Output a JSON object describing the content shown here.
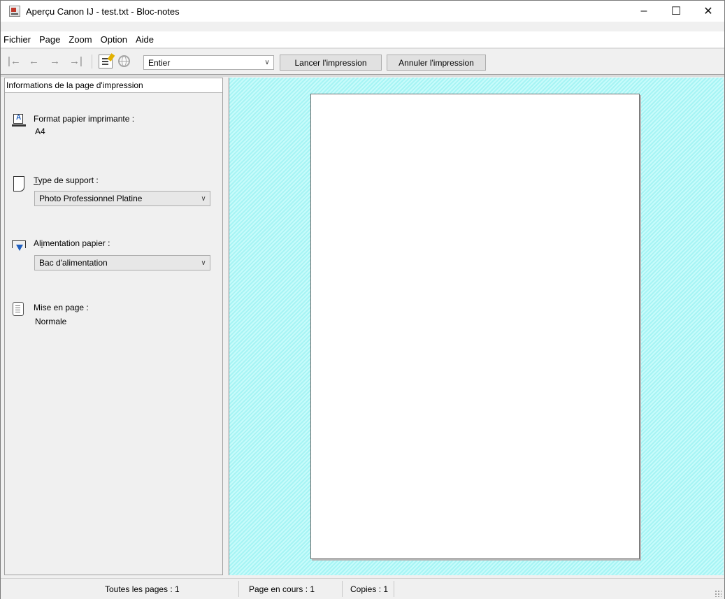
{
  "window": {
    "title": "Aperçu Canon IJ - test.txt - Bloc-notes",
    "controls": {
      "minimize": "–",
      "maximize": "☐",
      "close": "✕"
    }
  },
  "menu": [
    "Fichier",
    "Page",
    "Zoom",
    "Option",
    "Aide"
  ],
  "toolbar": {
    "nav_icons": [
      "first-page-icon",
      "previous-page-icon",
      "next-page-icon",
      "last-page-icon"
    ],
    "zoom_value": "Entier",
    "start_print_label": "Lancer l'impression",
    "cancel_print_label": "Annuler l'impression"
  },
  "panel": {
    "header": "Informations de la page d'impression",
    "paper_size": {
      "label": "Format papier imprimante :",
      "value": "A4"
    },
    "media_type": {
      "label_key": "T",
      "label_rest": "ype de support :",
      "value": "Photo Professionnel Platine"
    },
    "paper_source": {
      "label_pre": "Al",
      "label_key": "i",
      "label_rest": "mentation papier :",
      "value": "Bac d'alimentation"
    },
    "layout": {
      "label": "Mise en page :",
      "value": "Normale"
    }
  },
  "status": {
    "all_pages": "Toutes les pages :  1",
    "current_page": "Page en cours :  1",
    "copies": "Copies :  1"
  }
}
